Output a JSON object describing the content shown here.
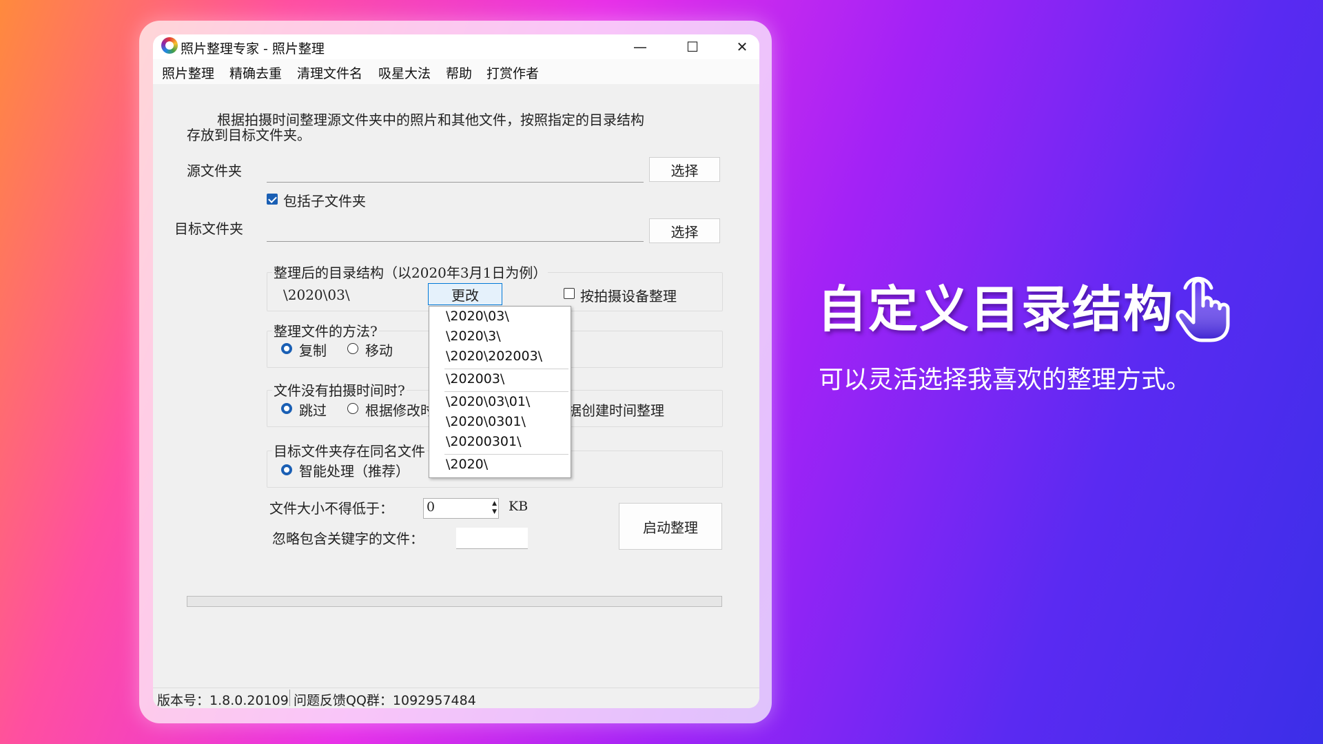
{
  "window": {
    "title": "照片整理专家 - 照片整理",
    "controls": {
      "minimize": "—",
      "maximize": "☐",
      "close": "✕"
    }
  },
  "menu": [
    "照片整理",
    "精确去重",
    "清理文件名",
    "吸星大法",
    "帮助",
    "打赏作者"
  ],
  "description": {
    "line1": "根据拍摄时间整理源文件夹中的照片和其他文件，按照指定的目录结构",
    "line2": "存放到目标文件夹。"
  },
  "source": {
    "label": "源文件夹",
    "value": "",
    "button": "选择"
  },
  "include_subfolders": {
    "label": "包括子文件夹",
    "checked": true
  },
  "target": {
    "label": "目标文件夹",
    "value": "",
    "button": "选择"
  },
  "structure": {
    "title": "整理后的目录结构（以2020年3月1日为例）",
    "current": "\\2020\\03\\",
    "change_button": "更改",
    "by_device": {
      "label": "按拍摄设备整理",
      "checked": false
    }
  },
  "dropdown_options": [
    "\\2020\\03\\",
    "\\2020\\3\\",
    "\\2020\\202003\\",
    "\\202003\\",
    "\\2020\\03\\01\\",
    "\\2020\\0301\\",
    "\\20200301\\",
    "\\2020\\"
  ],
  "method": {
    "title": "整理文件的方法?",
    "copy": "复制",
    "move": "移动",
    "selected": "copy"
  },
  "no_time": {
    "title": "文件没有拍摄时间时?",
    "skip": "跳过",
    "by_modified": "根据修改时",
    "by_created": "据创建时间整理",
    "selected": "skip"
  },
  "conflict": {
    "title": "目标文件夹存在同名文件",
    "smart": "智能处理（推荐）",
    "selected": "smart"
  },
  "min_size": {
    "label": "文件大小不得低于：",
    "value": "0",
    "unit": "KB"
  },
  "ignore_keyword": {
    "label": "忽略包含关键字的文件：",
    "value": ""
  },
  "start_button": "启动整理",
  "progress": 0,
  "status": {
    "version": "版本号：1.8.0.20109",
    "feedback": "问题反馈QQ群：1092957484"
  },
  "promo": {
    "title": "自定义目录结构",
    "subtitle": "可以灵活选择我喜欢的整理方式。",
    "icon": "pointer-hand-icon"
  },
  "colors": {
    "accent": "#1a5fb4",
    "window_bg": "#f0f0f0"
  }
}
